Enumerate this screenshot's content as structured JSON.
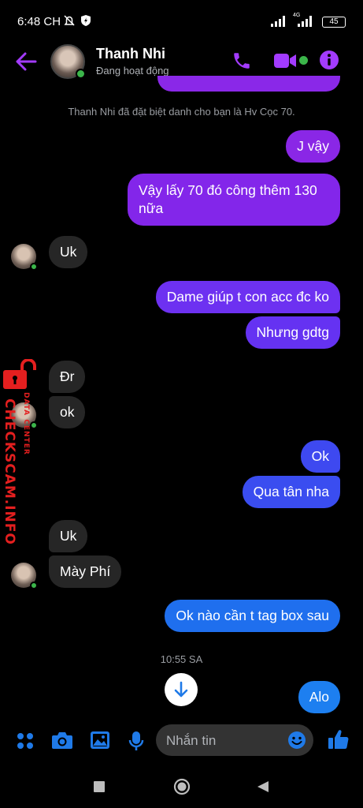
{
  "status_bar": {
    "time": "6:48 CH",
    "battery": "45",
    "network": "4G"
  },
  "header": {
    "name": "Thanh Nhi",
    "status": "Đang hoạt động"
  },
  "system_message": "Thanh Nhi đã đặt biệt danh cho bạn là Hv Cọc 70.",
  "messages": [
    {
      "text": "J vậy"
    },
    {
      "text": "Vậy lấy 70 đó công thêm 130"
    },
    {
      "text": "nữa"
    },
    {
      "text": "Uk"
    },
    {
      "text": "Dame giúp t con acc đc ko"
    },
    {
      "text": "Nhưng gdtg"
    },
    {
      "text": "Đr"
    },
    {
      "text": "ok"
    },
    {
      "text": "Ok"
    },
    {
      "text": "Qua tân nha"
    },
    {
      "text": "Uk"
    },
    {
      "text": "Mày Phí"
    },
    {
      "text": "Ok nào cần t tag box sau"
    },
    {
      "text": "Alo"
    }
  ],
  "timestamp": "10:55 SA",
  "composer": {
    "placeholder": "Nhắn tin"
  },
  "watermark": {
    "main": "CHECKSCAM.INFO",
    "sub": "DATA CENTER"
  },
  "colors": {
    "accent": "#a33bff",
    "blue": "#1f7ae8",
    "purple_bubble": "#7b2ff0",
    "incoming_bubble": "#262626",
    "online": "#3bb54a",
    "watermark": "#e41f1f"
  }
}
